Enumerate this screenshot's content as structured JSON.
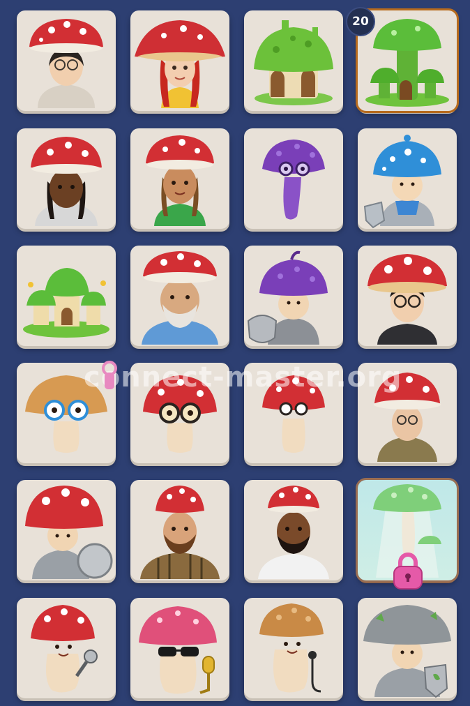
{
  "level_badge": "20",
  "watermark": "connect-master.org",
  "colors": {
    "background": "#2d3f72",
    "tile": "#e8e1d8",
    "red_cap": "#d22f34",
    "green_cap": "#6cc13a",
    "purple_cap": "#7a3fb8",
    "blue_cap": "#2f8fd8",
    "lock": "#e55aa8"
  },
  "tiles": [
    {
      "name": "woman-glasses-mushroom-hat",
      "icon": "woman-red-cap-icon"
    },
    {
      "name": "redhead-girl-big-hat",
      "icon": "redhead-girl-icon"
    },
    {
      "name": "green-mushroom-house",
      "icon": "mushroom-house-icon"
    },
    {
      "name": "green-mushroom-tower",
      "icon": "mushroom-tower-icon"
    },
    {
      "name": "woman-braids-dark",
      "icon": "woman-braids-icon"
    },
    {
      "name": "girl-braids-green-shirt",
      "icon": "girl-braids-icon"
    },
    {
      "name": "purple-mushroom-glasses",
      "icon": "purple-mushroom-icon"
    },
    {
      "name": "blue-mushroom-knight",
      "icon": "blue-knight-icon"
    },
    {
      "name": "mushroom-village",
      "icon": "mushroom-village-icon"
    },
    {
      "name": "old-man-beard",
      "icon": "old-man-icon"
    },
    {
      "name": "purple-mushroom-knight",
      "icon": "purple-knight-icon"
    },
    {
      "name": "man-glasses-cap",
      "icon": "man-glasses-icon"
    },
    {
      "name": "tan-mushroom-blue-glasses",
      "icon": "tan-mushroom-icon"
    },
    {
      "name": "red-mushroom-big-glasses",
      "icon": "red-mushroom-glasses-icon"
    },
    {
      "name": "small-red-mushroom-glasses",
      "icon": "small-mushroom-icon"
    },
    {
      "name": "old-man-hoodie",
      "icon": "old-man-hoodie-icon"
    },
    {
      "name": "red-mushroom-knight-shield",
      "icon": "red-knight-icon"
    },
    {
      "name": "bearded-man-plaid",
      "icon": "bearded-man-icon"
    },
    {
      "name": "bearded-man-white-shirt",
      "icon": "bearded-man-2-icon"
    },
    {
      "name": "locked-green-mushroom",
      "icon": "lock-icon"
    },
    {
      "name": "red-mushroom-singer",
      "icon": "singer-icon"
    },
    {
      "name": "pink-mushroom-sunglasses",
      "icon": "sunglasses-singer-icon"
    },
    {
      "name": "brown-mushroom-singer",
      "icon": "brown-singer-icon"
    },
    {
      "name": "grey-mushroom-knight",
      "icon": "grey-knight-icon"
    }
  ]
}
